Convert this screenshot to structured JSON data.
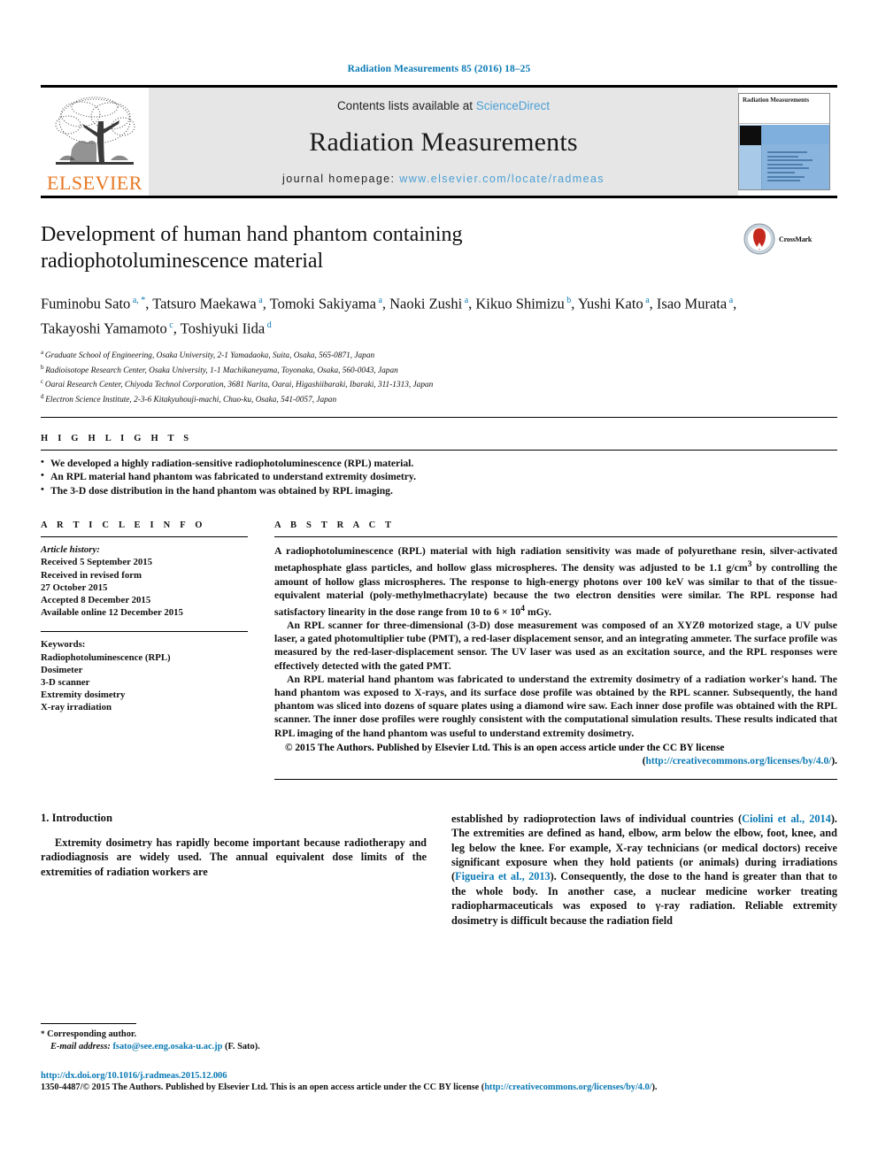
{
  "running_head": "Radiation Measurements 85 (2016) 18–25",
  "masthead": {
    "contents_prefix": "Contents lists available at ",
    "sciencedirect": "ScienceDirect",
    "journal_title": "Radiation Measurements",
    "homepage_prefix": "journal homepage: ",
    "homepage_url": "www.elsevier.com/locate/radmeas",
    "publisher_wordmark": "ELSEVIER",
    "cover_journal_name": "Radiation Measurements",
    "logo_icon": "elsevier-tree-logo"
  },
  "article": {
    "title": "Development of human hand phantom containing radiophotoluminescence material",
    "crossmark_label": "CrossMark"
  },
  "authors": [
    {
      "name": "Fuminobu Sato",
      "sup": "a, *"
    },
    {
      "name": "Tatsuro Maekawa",
      "sup": "a"
    },
    {
      "name": "Tomoki Sakiyama",
      "sup": "a"
    },
    {
      "name": "Naoki Zushi",
      "sup": "a"
    },
    {
      "name": "Kikuo Shimizu",
      "sup": "b"
    },
    {
      "name": "Yushi Kato",
      "sup": "a"
    },
    {
      "name": "Isao Murata",
      "sup": "a"
    },
    {
      "name": "Takayoshi Yamamoto",
      "sup": "c"
    },
    {
      "name": "Toshiyuki Iida",
      "sup": "d"
    }
  ],
  "affiliations": [
    {
      "mark": "a",
      "text": "Graduate School of Engineering, Osaka University, 2-1 Yamadaoka, Suita, Osaka, 565-0871, Japan"
    },
    {
      "mark": "b",
      "text": "Radioisotope Research Center, Osaka University, 1-1 Machikaneyama, Toyonaka, Osaka, 560-0043, Japan"
    },
    {
      "mark": "c",
      "text": "Oarai Research Center, Chiyoda Technol Corporation, 3681 Narita, Oarai, Higashiibaraki, Ibaraki, 311-1313, Japan"
    },
    {
      "mark": "d",
      "text": "Electron Science Institute, 2-3-6 Kitakyuhouji-machi, Chuo-ku, Osaka, 541-0057, Japan"
    }
  ],
  "highlights": {
    "label": "H I G H L I G H T S",
    "items": [
      "We developed a highly radiation-sensitive radiophotoluminescence (RPL) material.",
      "An RPL material hand phantom was fabricated to understand extremity dosimetry.",
      "The 3-D dose distribution in the hand phantom was obtained by RPL imaging."
    ]
  },
  "article_info": {
    "label": "A R T I C L E   I N F O",
    "history_label": "Article history:",
    "history": [
      "Received 5 September 2015",
      "Received in revised form",
      "27 October 2015",
      "Accepted 8 December 2015",
      "Available online 12 December 2015"
    ],
    "keywords_label": "Keywords:",
    "keywords": [
      "Radiophotoluminescence (RPL)",
      "Dosimeter",
      "3-D scanner",
      "Extremity dosimetry",
      "X-ray irradiation"
    ]
  },
  "abstract": {
    "label": "A B S T R A C T",
    "paragraphs": [
      "A radiophotoluminescence (RPL) material with high radiation sensitivity was made of polyurethane resin, silver-activated metaphosphate glass particles, and hollow glass microspheres. The density was adjusted to be 1.1 g/cm3 by controlling the amount of hollow glass microspheres. The response to high-energy photons over 100 keV was similar to that of the tissue-equivalent material (poly-methylmethacrylate) because the two electron densities were similar. The RPL response had satisfactory linearity in the dose range from 10 to 6 × 104 mGy.",
      "An RPL scanner for three-dimensional (3-D) dose measurement was composed of an XYZθ motorized stage, a UV pulse laser, a gated photomultiplier tube (PMT), a red-laser displacement sensor, and an integrating ammeter. The surface profile was measured by the red-laser-displacement sensor. The UV laser was used as an excitation source, and the RPL responses were effectively detected with the gated PMT.",
      "An RPL material hand phantom was fabricated to understand the extremity dosimetry of a radiation worker's hand. The hand phantom was exposed to X-rays, and its surface dose profile was obtained by the RPL scanner. Subsequently, the hand phantom was sliced into dozens of square plates using a diamond wire saw. Each inner dose profile was obtained with the RPL scanner. The inner dose profiles were roughly consistent with the computational simulation results. These results indicated that RPL imaging of the hand phantom was useful to understand extremity dosimetry."
    ],
    "copyright_text": "© 2015 The Authors. Published by Elsevier Ltd. This is an open access article under the CC BY license",
    "license_open": "(",
    "license_url": "http://creativecommons.org/licenses/by/4.0/",
    "license_close": ")."
  },
  "introduction": {
    "heading": "1. Introduction",
    "col_left": "Extremity dosimetry has rapidly become important because radiotherapy and radiodiagnosis are widely used. The annual equivalent dose limits of the extremities of radiation workers are",
    "col_right_part1": "established by radioprotection laws of individual countries (",
    "col_right_ref1": "Ciolini et al., 2014",
    "col_right_part2": "). The extremities are defined as hand, elbow, arm below the elbow, foot, knee, and leg below the knee. For example, X-ray technicians (or medical doctors) receive significant exposure when they hold patients (or animals) during irradiations (",
    "col_right_ref2": "Figueira et al., 2013",
    "col_right_part3": "). Consequently, the dose to the hand is greater than that to the whole body. In another case, a nuclear medicine worker treating radiopharmaceuticals was exposed to γ-ray radiation. Reliable extremity dosimetry is difficult because the radiation field"
  },
  "footnote": {
    "corresponding": "Corresponding author.",
    "email_label": "E-mail address:",
    "email": "fsato@see.eng.osaka-u.ac.jp",
    "email_suffix": "(F. Sato)."
  },
  "footer": {
    "doi": "http://dx.doi.org/10.1016/j.radmeas.2015.12.006",
    "issn_prefix": "1350-4487/© 2015 The Authors. Published by Elsevier Ltd. This is an open access article under the CC BY license (",
    "issn_license_url": "http://creativecommons.org/licenses/by/4.0/",
    "issn_suffix": ")."
  },
  "colors": {
    "link": "#0b7ab5",
    "sciencedirect": "#4a9fd4",
    "elsevier_orange": "#E87722",
    "masthead_bg": "#e6e6e6"
  }
}
